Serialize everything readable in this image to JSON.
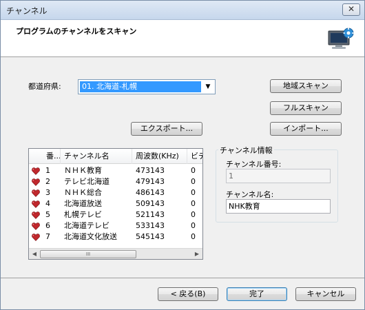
{
  "window": {
    "title": "チャンネル",
    "close_glyph": "✕"
  },
  "header": {
    "title": "プログラムのチャンネルをスキャン",
    "icon": "tv-settings-icon"
  },
  "region": {
    "label": "都道府県:",
    "selected": "01. 北海道-札幌"
  },
  "buttons": {
    "region_scan": "地域スキャン",
    "full_scan": "フルスキャン",
    "export": "エクスポート...",
    "import": "インポート...",
    "back": "< 戻る(B)",
    "finish": "完了",
    "cancel": "キャンセル"
  },
  "channel_list": {
    "columns": [
      "番...",
      "チャンネル名",
      "周波数(KHz)",
      "ビデ"
    ],
    "rows": [
      {
        "num": "1",
        "name": "ＮＨＫ教育",
        "freq": "473143",
        "video": "0"
      },
      {
        "num": "2",
        "name": "テレビ北海道",
        "freq": "479143",
        "video": "0"
      },
      {
        "num": "3",
        "name": "ＮＨＫ総合",
        "freq": "486143",
        "video": "0"
      },
      {
        "num": "4",
        "name": "北海道放送",
        "freq": "509143",
        "video": "0"
      },
      {
        "num": "5",
        "name": "札幌テレビ",
        "freq": "521143",
        "video": "0"
      },
      {
        "num": "6",
        "name": "北海道テレビ",
        "freq": "533143",
        "video": "0"
      },
      {
        "num": "7",
        "name": "北海道文化放送",
        "freq": "545143",
        "video": "0"
      }
    ],
    "favorite_icon": "heart-icon",
    "favorite_color": "#c0282d",
    "scroll_grip": "III"
  },
  "channel_info": {
    "legend": "チャンネル情報",
    "number_label": "チャンネル番号:",
    "number_value": "1",
    "name_label": "チャンネル名:",
    "name_value": "NHK教育"
  },
  "colors": {
    "selection": "#3399ff",
    "window_bg": "#f0f0f0"
  }
}
